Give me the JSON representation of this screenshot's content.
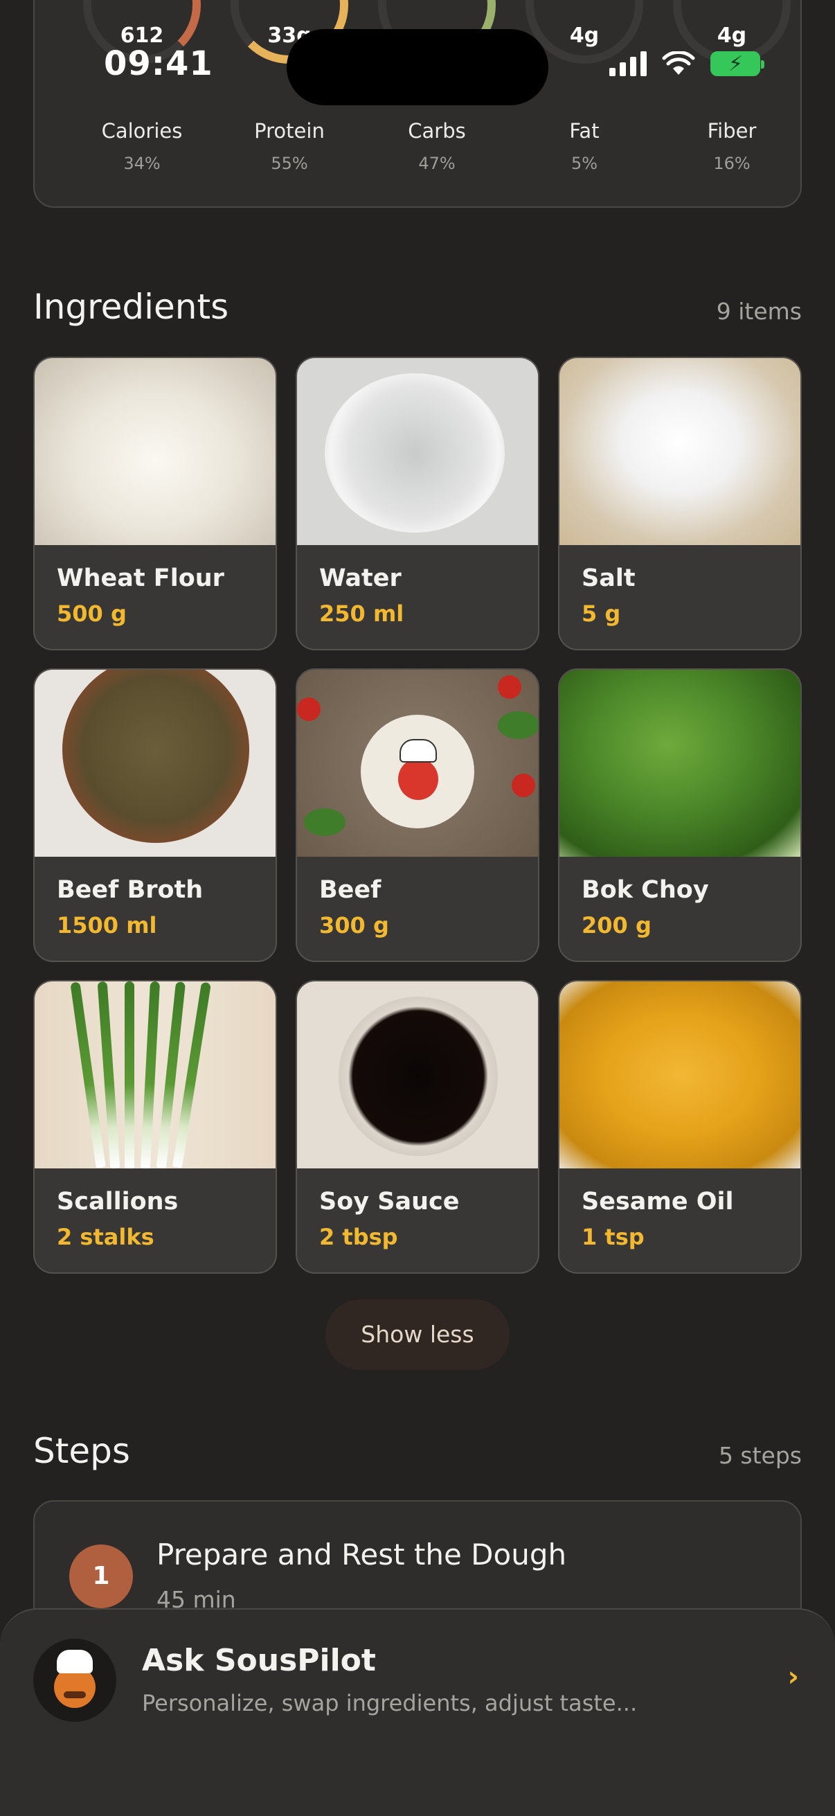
{
  "status_bar": {
    "time": "09:41"
  },
  "nutrition": [
    {
      "value": "612",
      "label": "Calories",
      "percent": "34%"
    },
    {
      "value": "33g",
      "label": "Protein",
      "percent": "55%"
    },
    {
      "value": "",
      "label": "Carbs",
      "percent": "47%"
    },
    {
      "value": "4g",
      "label": "Fat",
      "percent": "5%"
    },
    {
      "value": "4g",
      "label": "Fiber",
      "percent": "16%"
    }
  ],
  "ingredients": {
    "title": "Ingredients",
    "count": "9 items",
    "items": [
      {
        "name": "Wheat Flour",
        "qty": "500 g"
      },
      {
        "name": "Water",
        "qty": "250 ml"
      },
      {
        "name": "Salt",
        "qty": "5 g"
      },
      {
        "name": "Beef Broth",
        "qty": "1500 ml"
      },
      {
        "name": "Beef",
        "qty": "300 g"
      },
      {
        "name": "Bok Choy",
        "qty": "200 g"
      },
      {
        "name": "Scallions",
        "qty": "2 stalks"
      },
      {
        "name": "Soy Sauce",
        "qty": "2 tbsp"
      },
      {
        "name": "Sesame Oil",
        "qty": "1 tsp"
      }
    ],
    "toggle_label": "Show less"
  },
  "steps": {
    "title": "Steps",
    "count": "5 steps",
    "items": [
      {
        "number": "1",
        "title": "Prepare and Rest the Dough",
        "duration": "45 min"
      }
    ]
  },
  "assistant": {
    "title": "Ask SousPilot",
    "subtitle": "Personalize, swap ingredients, adjust taste...",
    "chevron": "›"
  },
  "colors": {
    "background": "#232221",
    "card": "#393735",
    "accent_quantity": "#f2b830",
    "step_badge": "#b0603e"
  }
}
